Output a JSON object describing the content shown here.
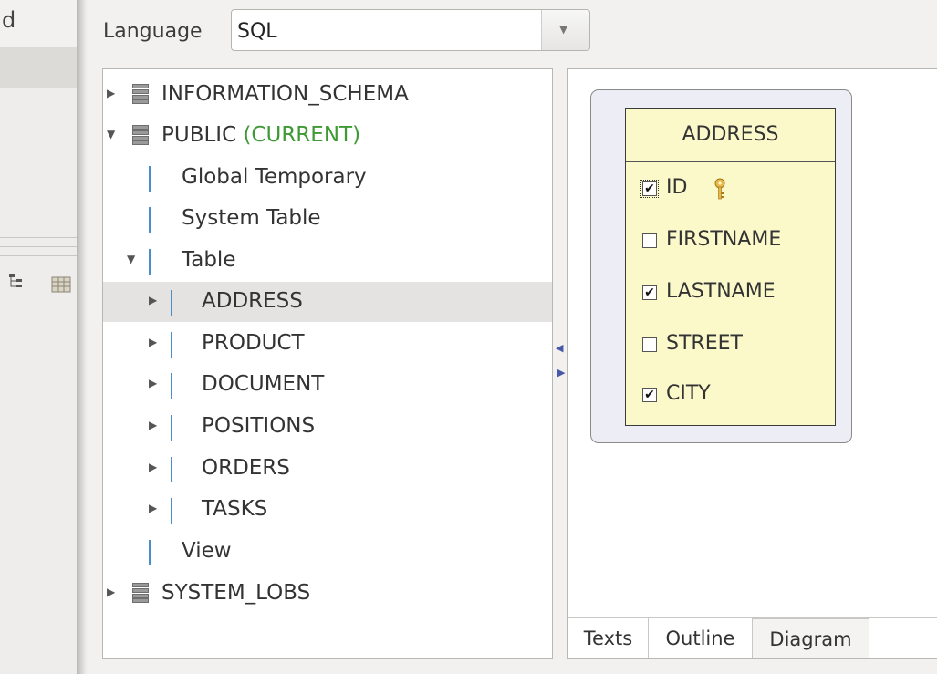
{
  "left_strip": {
    "top_text": "d"
  },
  "language": {
    "label": "Language",
    "value": "SQL"
  },
  "tree": {
    "rows": [
      {
        "label": "INFORMATION_SCHEMA",
        "expanded": false,
        "icon": "schema-icon"
      },
      {
        "label": "PUBLIC",
        "suffix": "(CURRENT)",
        "expanded": true,
        "icon": "schema-icon"
      },
      {
        "label": "Global Temporary",
        "icon": "table-icon"
      },
      {
        "label": "System Table",
        "icon": "table-icon"
      },
      {
        "label": "Table",
        "expanded": true,
        "icon": "table-icon"
      },
      {
        "label": "ADDRESS",
        "expanded": false,
        "selected": true,
        "icon": "table-icon"
      },
      {
        "label": "PRODUCT",
        "expanded": false,
        "icon": "table-icon"
      },
      {
        "label": "DOCUMENT",
        "expanded": false,
        "icon": "table-icon"
      },
      {
        "label": "POSITIONS",
        "expanded": false,
        "icon": "table-icon"
      },
      {
        "label": "ORDERS",
        "expanded": false,
        "icon": "table-icon"
      },
      {
        "label": "TASKS",
        "expanded": false,
        "icon": "table-icon"
      },
      {
        "label": "View",
        "icon": "table-icon"
      },
      {
        "label": "SYSTEM_LOBS",
        "expanded": false,
        "icon": "schema-icon"
      }
    ]
  },
  "diagram": {
    "entity": {
      "title": "ADDRESS",
      "columns": [
        {
          "name": "ID",
          "checked": true,
          "primary_key": true
        },
        {
          "name": "FIRSTNAME",
          "checked": false
        },
        {
          "name": "LASTNAME",
          "checked": true
        },
        {
          "name": "STREET",
          "checked": false
        },
        {
          "name": "CITY",
          "checked": true
        }
      ]
    }
  },
  "tabs": [
    {
      "label": "Texts",
      "active": false
    },
    {
      "label": "Outline",
      "active": false
    },
    {
      "label": "Diagram",
      "active": true
    }
  ],
  "colors": {
    "current_green": "#3f9a35",
    "entity_fill": "#fbf9c9",
    "frame_fill": "#edeef5"
  }
}
